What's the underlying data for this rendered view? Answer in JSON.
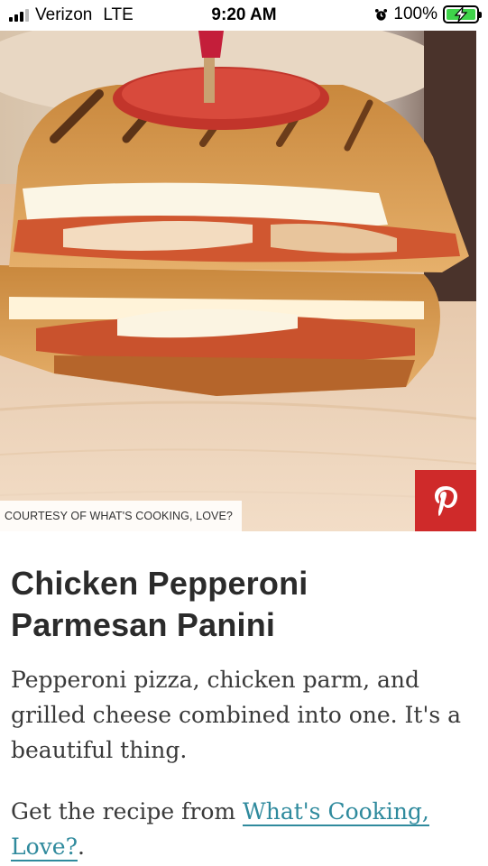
{
  "status_bar": {
    "carrier": "Verizon",
    "network": "LTE",
    "time": "9:20 AM",
    "battery": "100%",
    "battery_level": 1.0,
    "signal_bars_total": 4,
    "signal_bars_active": 3
  },
  "hero": {
    "alt": "Chicken Pepperoni Parmesan Panini",
    "credit": "COURTESY OF WHAT'S COOKING, LOVE?",
    "pinterest_icon": "pinterest-icon"
  },
  "article": {
    "title": "Chicken Pepperoni Parmesan Panini",
    "description": "Pepperoni pizza, chicken parm, and grilled cheese combined into one. It's a beautiful thing.",
    "recipe_prefix": "Get the recipe from ",
    "recipe_link": "What's Cooking, Love?",
    "recipe_suffix": "."
  },
  "colors": {
    "pinterest_red": "#cf2a2a",
    "link": "#2f8a9d",
    "battery_green": "#3fd34a"
  }
}
